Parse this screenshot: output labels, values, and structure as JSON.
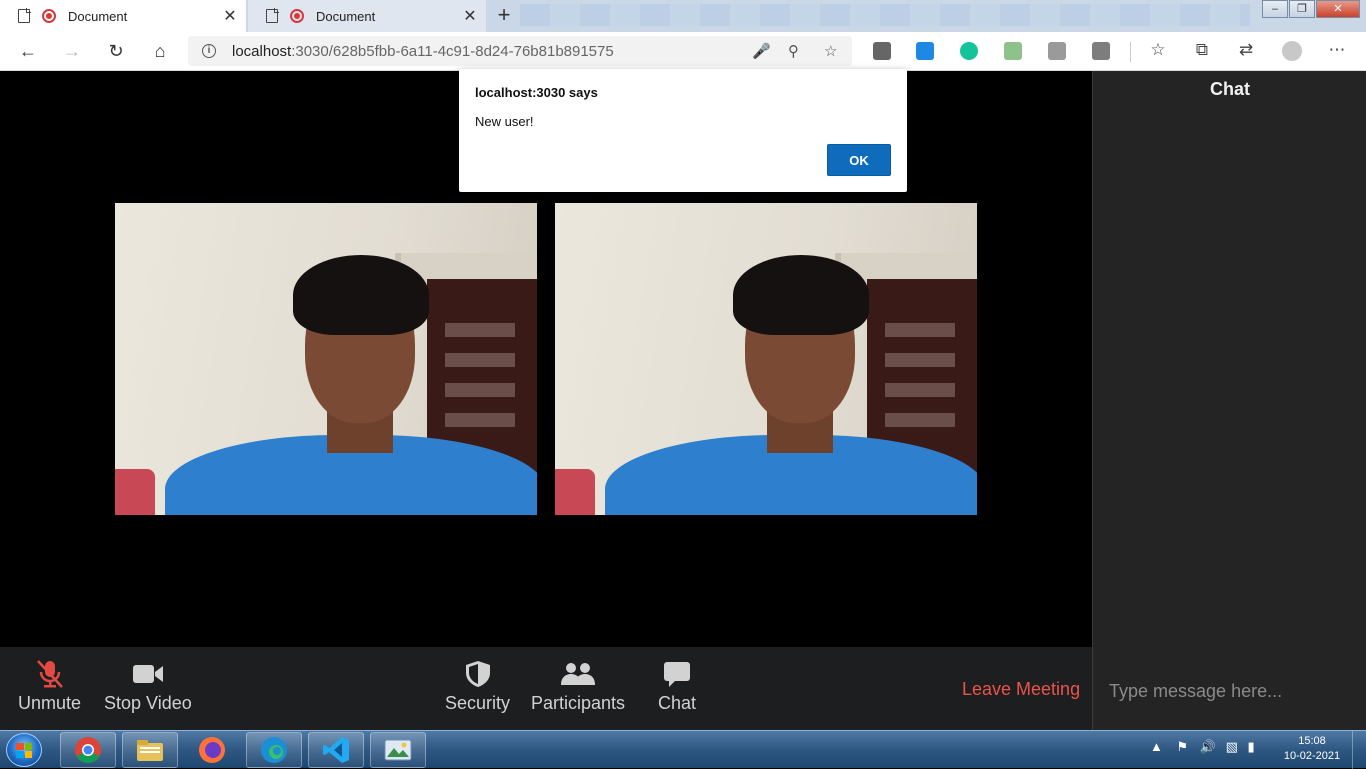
{
  "browser": {
    "tabs": [
      {
        "title": "Document",
        "active": true
      },
      {
        "title": "Document",
        "active": false
      }
    ],
    "new_tab": "+",
    "close_glyph": "✕",
    "url_host": "localhost",
    "url_rest": ":3030/628b5fbb-6a11-4c91-8d24-76b81b891575",
    "window_controls": [
      "minimize",
      "restore",
      "close"
    ]
  },
  "alert": {
    "origin": "localhost:3030 says",
    "message": "New user!",
    "ok_label": "OK"
  },
  "videos": [
    {
      "name": "video-tile-local"
    },
    {
      "name": "video-tile-remote"
    }
  ],
  "controls": {
    "unmute": "Unmute",
    "stop_video": "Stop Video",
    "security": "Security",
    "participants": "Participants",
    "chat": "Chat",
    "leave": "Leave Meeting"
  },
  "chat_panel": {
    "title": "Chat",
    "input_placeholder": "Type message here..."
  },
  "taskbar": {
    "apps": [
      "chrome-icon",
      "file-explorer-icon",
      "firefox-icon",
      "edge-icon",
      "vscode-icon",
      "photo-viewer-icon"
    ],
    "time": "15:08",
    "date": "10-02-2021"
  },
  "colors": {
    "leave": "#eb534b",
    "mute_red": "#e24a42",
    "ok_button": "#0f6cbd",
    "panel_bg": "#242424",
    "controls_bg": "#1c1e20"
  }
}
